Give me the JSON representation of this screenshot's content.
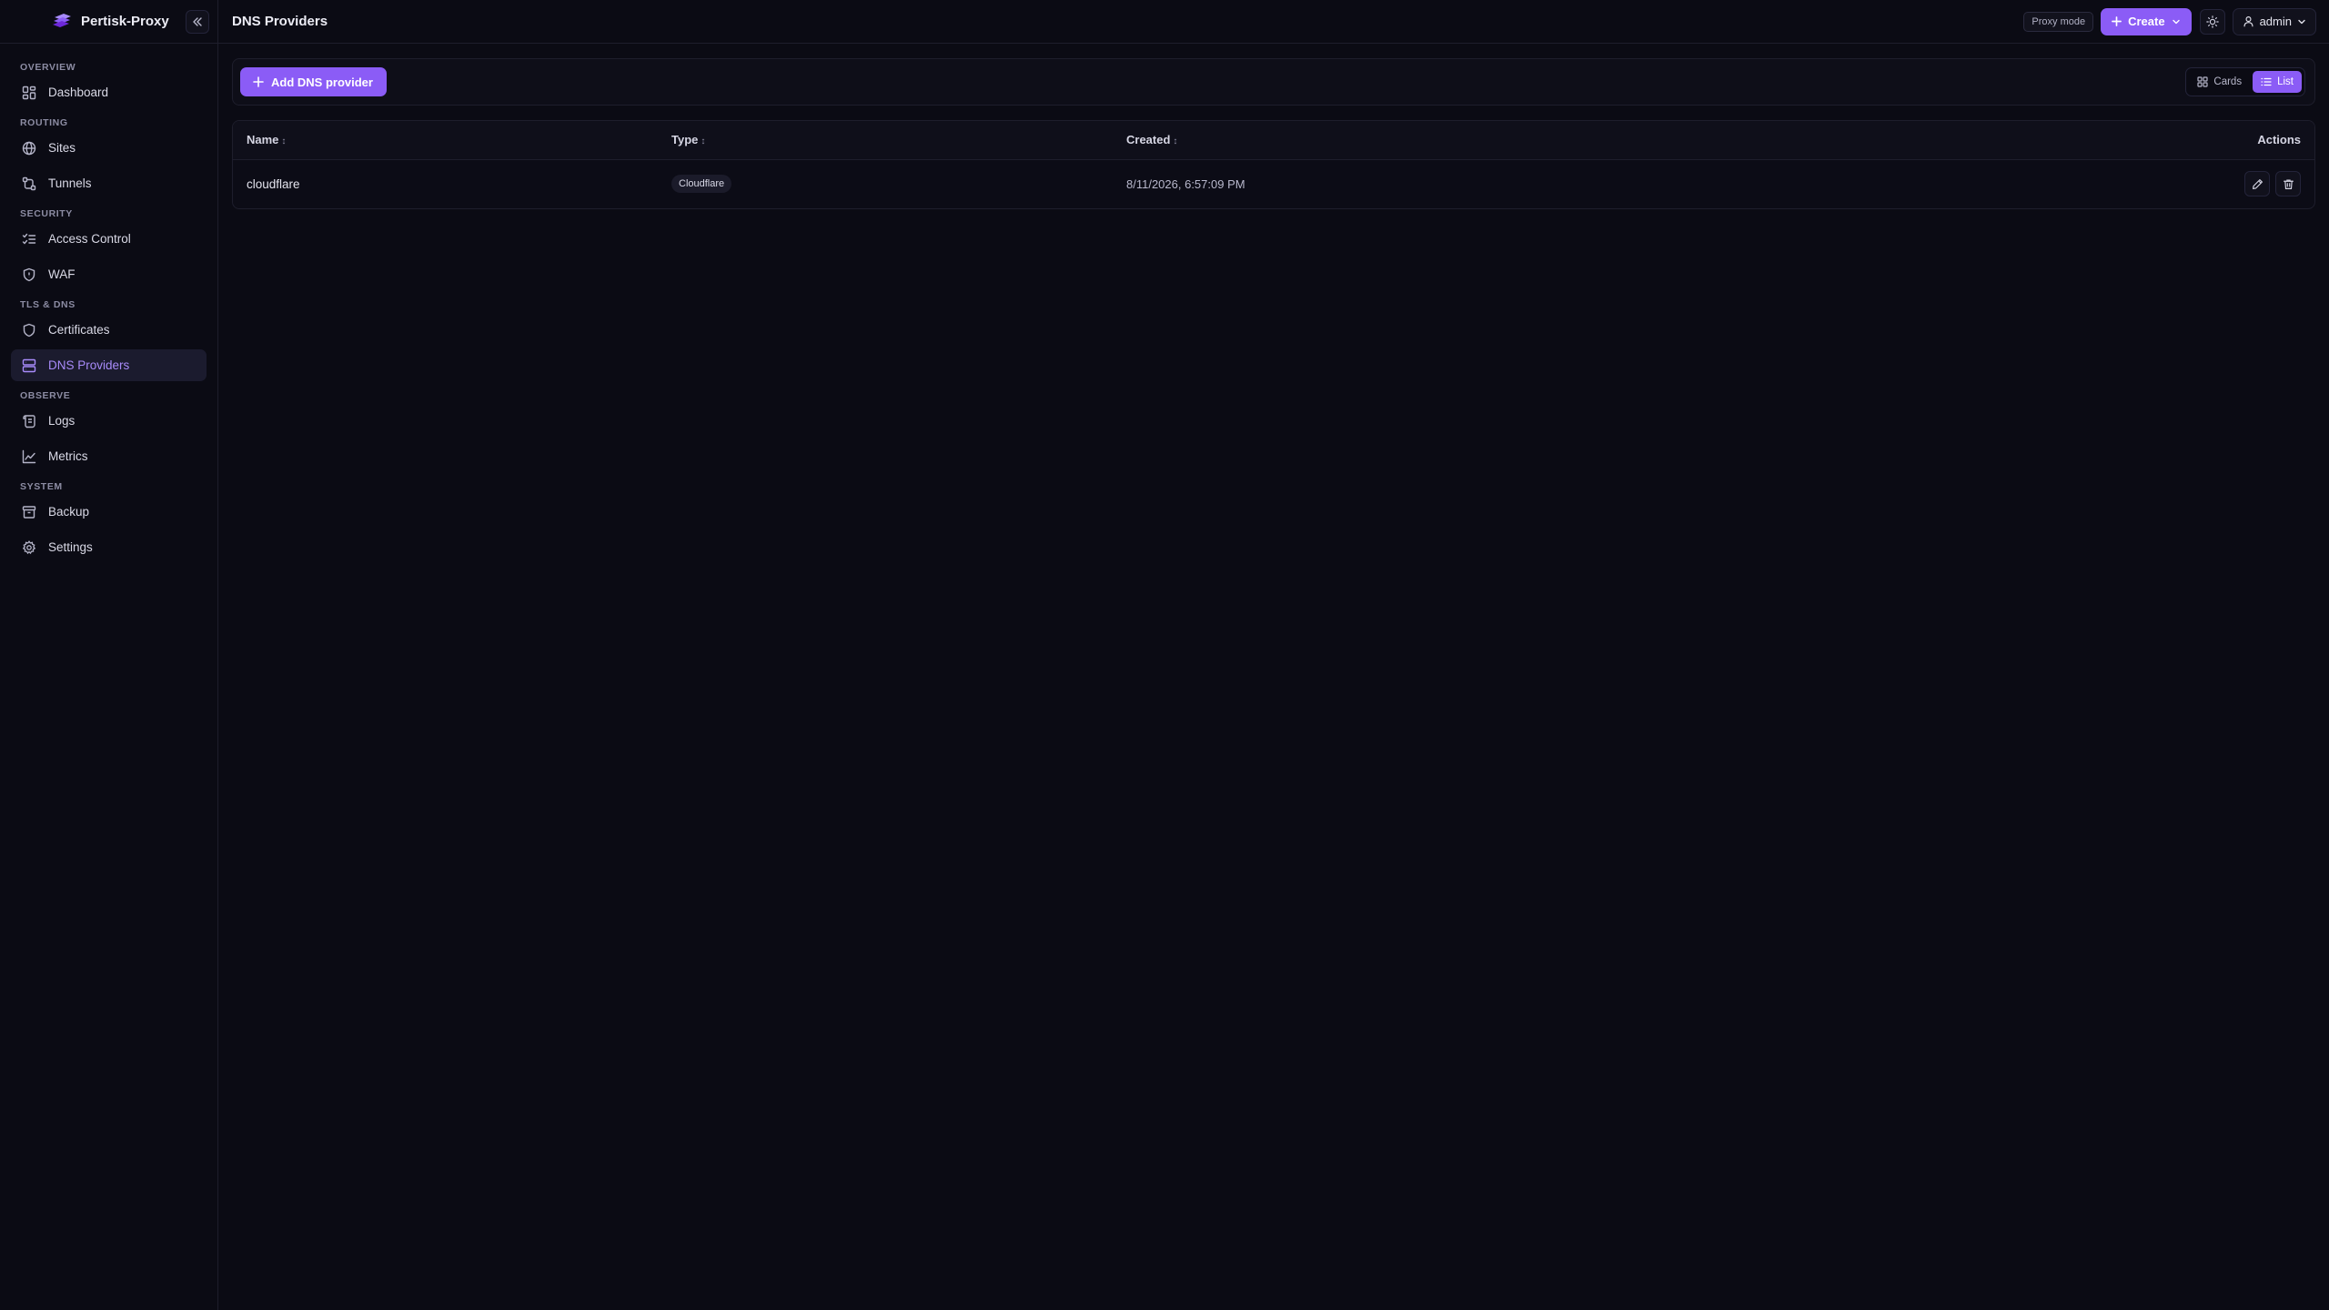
{
  "app": {
    "name": "Pertisk-Proxy"
  },
  "header": {
    "title": "DNS Providers",
    "proxy_mode": "Proxy mode",
    "create_label": "Create",
    "user": "admin"
  },
  "sidebar": {
    "sections": [
      {
        "title": "OVERVIEW",
        "items": [
          {
            "label": "Dashboard",
            "icon": "dashboard-icon"
          }
        ]
      },
      {
        "title": "ROUTING",
        "items": [
          {
            "label": "Sites",
            "icon": "globe-icon"
          },
          {
            "label": "Tunnels",
            "icon": "tunnel-icon"
          }
        ]
      },
      {
        "title": "SECURITY",
        "items": [
          {
            "label": "Access Control",
            "icon": "list-checks-icon"
          },
          {
            "label": "WAF",
            "icon": "shield-icon"
          }
        ]
      },
      {
        "title": "TLS & DNS",
        "items": [
          {
            "label": "Certificates",
            "icon": "shield-icon"
          },
          {
            "label": "DNS Providers",
            "icon": "server-icon",
            "active": true
          }
        ]
      },
      {
        "title": "OBSERVE",
        "items": [
          {
            "label": "Logs",
            "icon": "scroll-icon"
          },
          {
            "label": "Metrics",
            "icon": "line-chart-icon"
          }
        ]
      },
      {
        "title": "SYSTEM",
        "items": [
          {
            "label": "Backup",
            "icon": "archive-icon"
          },
          {
            "label": "Settings",
            "icon": "gear-icon"
          }
        ]
      }
    ]
  },
  "toolbar": {
    "add_label": "Add DNS provider",
    "view_cards": "Cards",
    "view_list": "List",
    "active_view": "List"
  },
  "table": {
    "columns": {
      "name": "Name",
      "type": "Type",
      "created": "Created",
      "actions": "Actions"
    },
    "rows": [
      {
        "name": "cloudflare",
        "type": "Cloudflare",
        "created": "8/11/2026, 6:57:09 PM"
      }
    ]
  },
  "colors": {
    "accent": "#8b5cf6",
    "active_text": "#a88bfa",
    "background": "#0b0b14"
  }
}
